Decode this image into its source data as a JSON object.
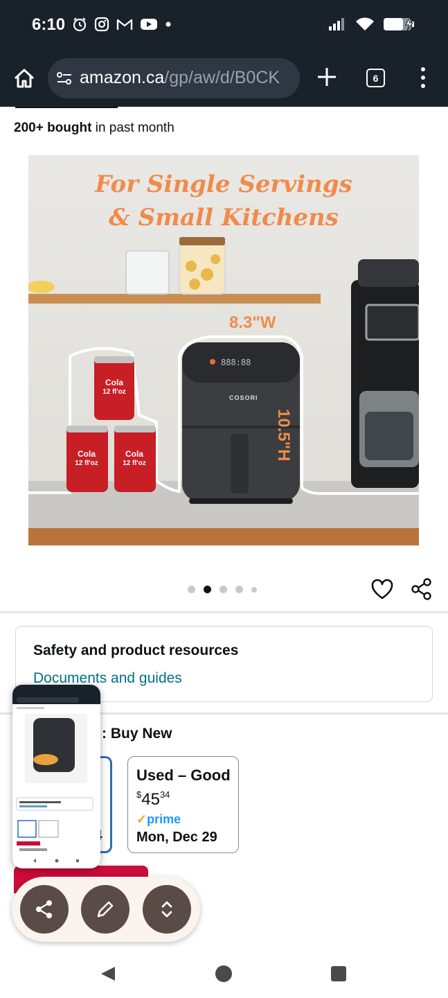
{
  "status_bar": {
    "time": "6:10",
    "left_icons": [
      "alarm-icon",
      "instagram-icon",
      "gmail-icon",
      "youtube-icon",
      "dot-icon"
    ],
    "right_icons": [
      "signal-icon",
      "wifi-icon",
      "battery-charging-icon"
    ]
  },
  "browser": {
    "url_host": "amazon.ca",
    "url_path": "/gp/aw/d/B0CK",
    "tab_count": "6"
  },
  "product": {
    "bought_bold": "200+ bought",
    "bought_rest": " in past month",
    "image": {
      "headline_1": "For Single Servings",
      "headline_2": "& Small Kitchens",
      "width_label": "8.3\"W",
      "height_label": "10.5\"H",
      "brand": "COSORI",
      "display_digits": "888:88",
      "can_label_1": "Cola",
      "can_label_2": "12 fl'oz"
    },
    "carousel": {
      "total": 5,
      "active_index": 1
    }
  },
  "resources": {
    "title": "Safety and product resources",
    "link": "Documents and guides"
  },
  "buying": {
    "heading_suffix": ": Buy New",
    "new_fragment": "4",
    "used": {
      "title": "Used – Good",
      "currency": "$",
      "price_whole": "45",
      "price_fraction": "34",
      "prime_label": "prime",
      "delivery": "Mon, Dec 29"
    }
  },
  "colors": {
    "status_bg": "#19212b",
    "link": "#007185",
    "accent_orange": "#f08b4a",
    "prime_blue": "#1a98ff",
    "deal_red": "#cc0c39",
    "fab_brown": "#5a4b46"
  }
}
